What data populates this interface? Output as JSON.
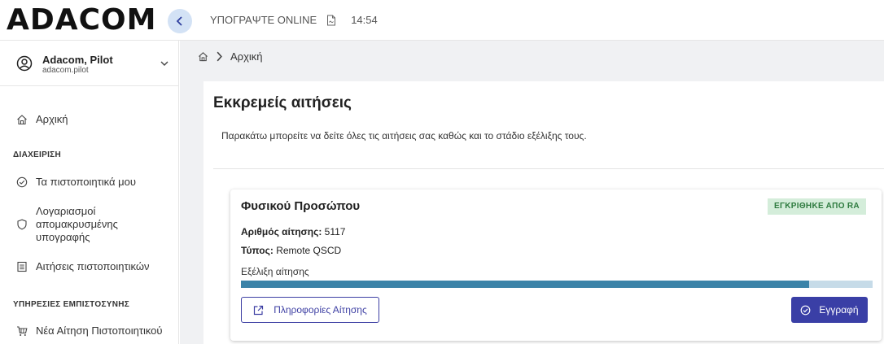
{
  "header": {
    "logo": "ADACOM",
    "sign_online": "ΥΠΟΓΡΑΨΤΕ ONLINE",
    "time": "14:54"
  },
  "user": {
    "name": "Adacom, Pilot",
    "login": "adacom.pilot"
  },
  "sidebar": {
    "home": "Αρχική",
    "section_manage": "ΔΙΑΧΕΙΡΙΣΗ",
    "my_certificates": "Τα πιστοποιητικά μου",
    "remote_sign_accounts": [
      "Λογαριασμοί",
      "απομακρυσμένης",
      "υπογραφής"
    ],
    "certificate_requests": "Αιτήσεις πιστοποιητικών",
    "section_trust": "ΥΠΗΡΕΣΙΕΣ ΕΜΠΙΣΤΟΣΥΝΗΣ",
    "new_request": "Νέα Αίτηση Πιστοποιητικού"
  },
  "breadcrumb": {
    "current": "Αρχική"
  },
  "main": {
    "title": "Εκκρεμείς αιτήσεις",
    "description": "Παρακάτω μπορείτε να δείτε όλες τις αιτήσεις σας καθώς και το στάδιο εξέλιξης τους."
  },
  "request_card": {
    "title": "Φυσικού Προσώπου",
    "status": "ΕΓΚΡΙΘΗΚΕ ΑΠΟ RA",
    "request_number_label": "Αριθμός αίτησης:",
    "request_number": "5117",
    "type_label": "Τύπος:",
    "type": "Remote QSCD",
    "progress_label": "Εξέλιξη αίτησης",
    "progress": 0.9,
    "info_button": "Πληροφορίες Αίτησης",
    "register_button": "Εγγραφή"
  },
  "colors": {
    "accent": "#3a3fa6",
    "progress": "#3b83a8",
    "status_bg": "#d4edda",
    "status_text": "#2d7a3e"
  }
}
